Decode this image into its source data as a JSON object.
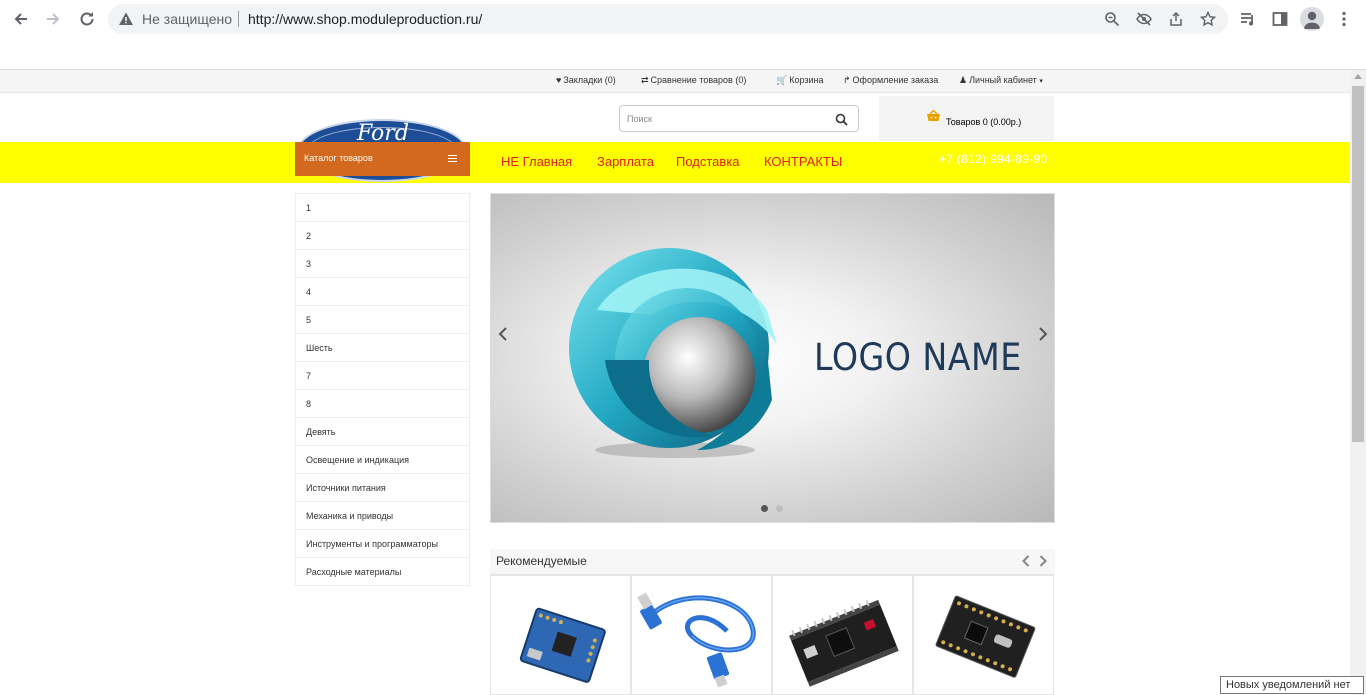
{
  "browser": {
    "security_label": "Не защищено",
    "url": "http://www.shop.moduleproduction.ru/"
  },
  "top_links": {
    "bookmarks": "Закладки (0)",
    "compare": "Сравнение товаров (0)",
    "cart": "Корзина",
    "checkout": "Оформление заказа",
    "account": "Личный кабинет"
  },
  "logo_script": "Ford",
  "search": {
    "placeholder": "Поиск"
  },
  "cart_summary": "Товаров 0 (0.00р.)",
  "catalog": {
    "label": "Каталог товаров",
    "items": [
      "1",
      "2",
      "3",
      "4",
      "5",
      "Шесть",
      "7",
      "8",
      "Девять",
      "Освещение и индикация",
      "Источники питания",
      "Механика и приводы",
      "Инструменты и программаторы",
      "Расходные материалы"
    ]
  },
  "menu": [
    "НЕ Главная",
    "Зарплата",
    "Подставка",
    "КОНТРАКТЫ"
  ],
  "phone": "+7 (812) 994-89-90",
  "slider": {
    "logo_text": "LOGO NAME",
    "total_slides": 2,
    "active_slide": 1
  },
  "recommended": {
    "title": "Рекомендуемые",
    "products": [
      "module-board",
      "usb-cable",
      "black-dev-board",
      "pro-mini-board"
    ]
  },
  "notification": "Новых уведомлений нет",
  "colors": {
    "band": "#ffff00",
    "catalog": "#d2691e",
    "menu_link": "#e02020",
    "phone": "#ffffff"
  }
}
